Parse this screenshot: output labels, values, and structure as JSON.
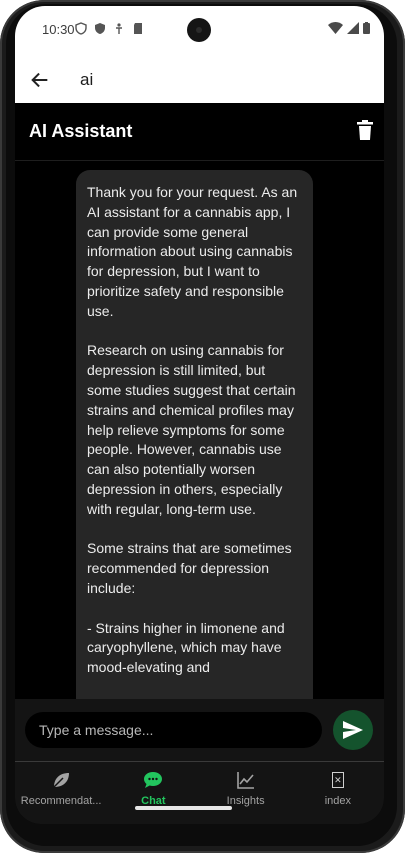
{
  "status_bar": {
    "time": "10:30"
  },
  "app_bar": {
    "title": "ai"
  },
  "chat_header": {
    "title": "AI Assistant"
  },
  "message": {
    "text": "Thank you for your request. As an AI assistant for a cannabis app, I can provide some general information about using cannabis for depression, but I want to prioritize safety and responsible use.\n\nResearch on using cannabis for depression is still limited, but some studies suggest that certain strains and chemical profiles may help relieve symptoms for some people. However, cannabis use can also potentially worsen depression in others, especially with regular, long-term use.\n\nSome strains that are sometimes recommended for depression include:\n\n- Strains higher in limonene and caryophyllene, which may have mood-elevating and"
  },
  "composer": {
    "placeholder": "Type a message..."
  },
  "bottom_nav": {
    "items": [
      {
        "label": "Recommendat...",
        "icon": "leaf-icon"
      },
      {
        "label": "Chat",
        "icon": "chat-bubble-icon"
      },
      {
        "label": "Insights",
        "icon": "line-chart-icon"
      },
      {
        "label": "index",
        "icon": "missing-glyph-icon"
      }
    ],
    "active": "Chat"
  },
  "colors": {
    "accent": "#22c55e",
    "send_button": "#14532d",
    "bubble": "#262626",
    "background": "#000000"
  }
}
